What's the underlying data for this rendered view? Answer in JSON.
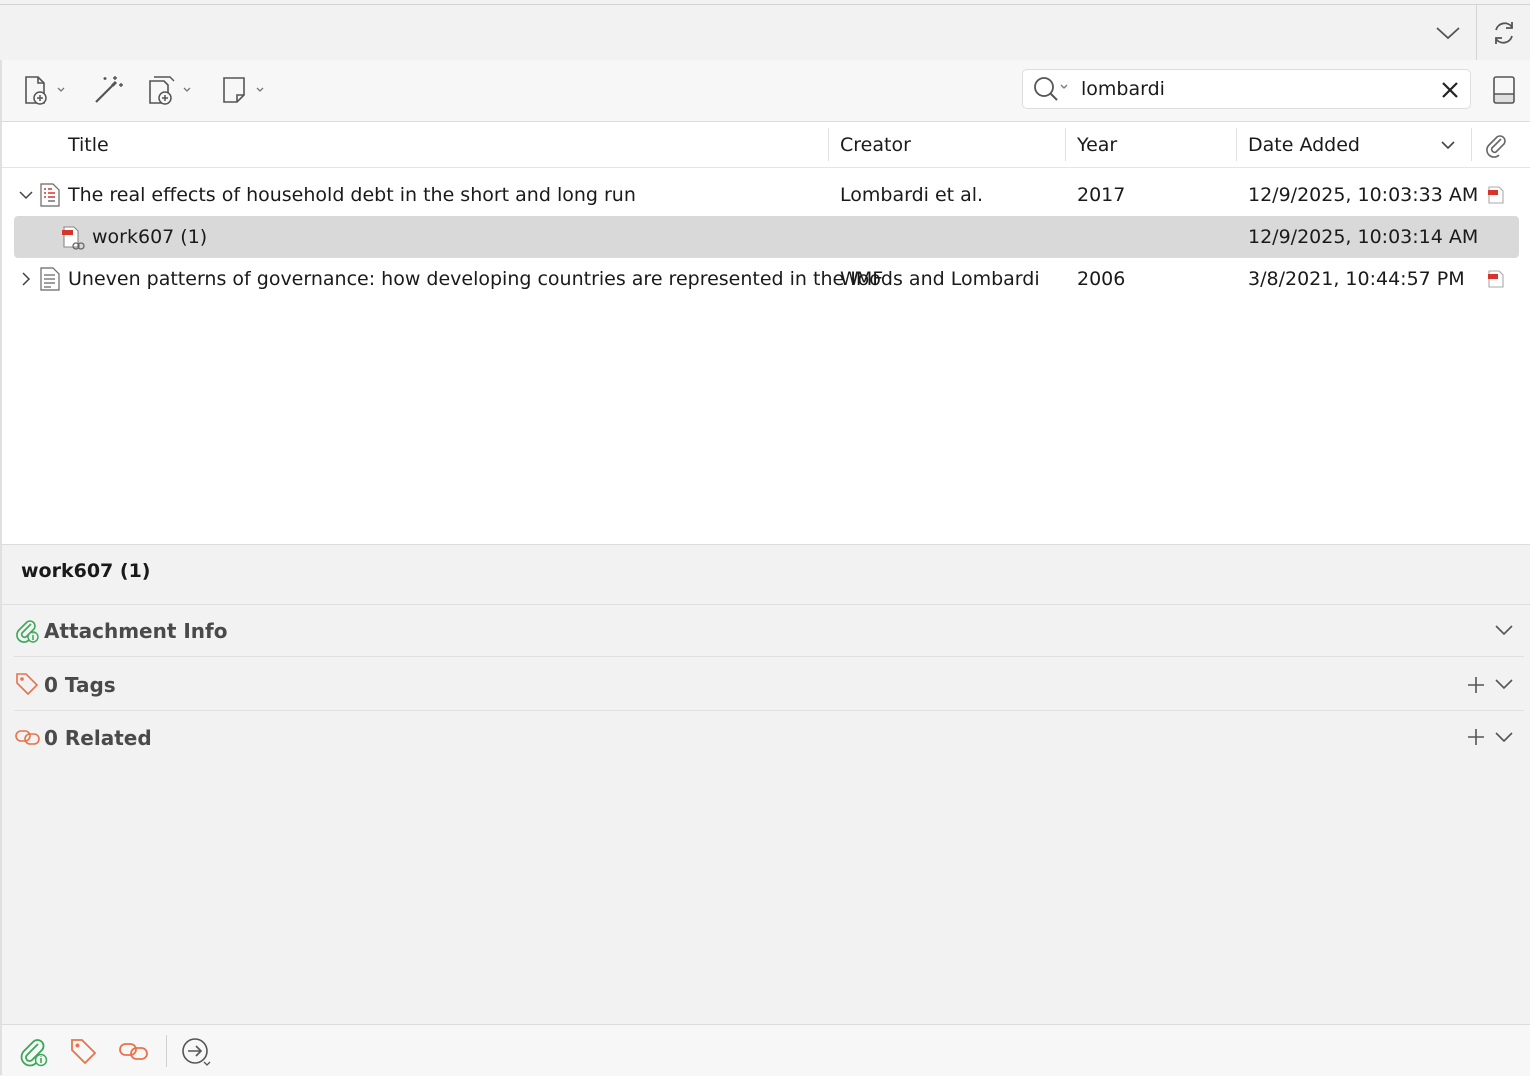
{
  "search": {
    "value": "lombardi",
    "placeholder": ""
  },
  "columns": {
    "title": "Title",
    "creator": "Creator",
    "year": "Year",
    "date_added": "Date Added"
  },
  "rows": [
    {
      "title": "The real effects of household debt in the short and long run",
      "creator": "Lombardi et al.",
      "year": "2017",
      "date_added": "12/9/2025, 10:03:33 AM",
      "expanded": true,
      "has_pdf": true
    },
    {
      "title": "work607 (1)",
      "creator": "",
      "year": "",
      "date_added": "12/9/2025, 10:03:14 AM",
      "child": true,
      "selected": true
    },
    {
      "title": "Uneven patterns of governance: how developing countries are represented in the IMF",
      "creator": "Woods and Lombardi",
      "year": "2006",
      "date_added": "3/8/2021, 10:44:57 PM",
      "expanded": false,
      "has_pdf": true
    }
  ],
  "item_pane": {
    "title": "work607 (1)",
    "sections": {
      "attachment_info": "Attachment Info",
      "tags": "0 Tags",
      "related": "0 Related"
    }
  },
  "colors": {
    "attachment_green": "#3aa858",
    "tag_orange": "#e8734a",
    "pdf_red": "#d9342b",
    "selected_row": "#d9d9d9"
  },
  "icons": {
    "toolbar": [
      "new-item-icon",
      "magic-wand-icon",
      "add-attachment-icon",
      "new-note-icon"
    ],
    "topbar": [
      "collapse-chevron-icon",
      "sync-icon"
    ],
    "footer": [
      "attachment-info-icon",
      "tags-icon",
      "related-icon",
      "locate-icon"
    ]
  }
}
